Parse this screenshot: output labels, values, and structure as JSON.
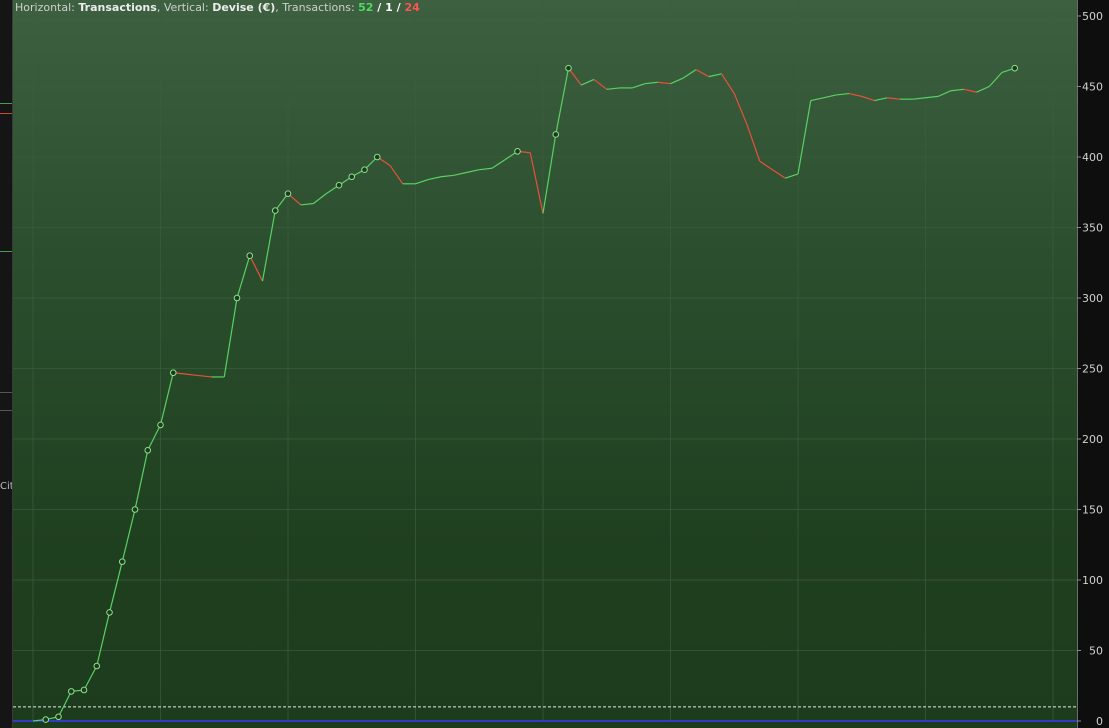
{
  "header": {
    "horizontal_label": "Horizontal:",
    "horizontal_value": "Transactions",
    "vertical_label": "Vertical:",
    "vertical_value": "Devise (€)",
    "transactions_label": "Transactions:",
    "count_green": "52",
    "separator1": " / ",
    "count_white": "1",
    "separator2": " / ",
    "count_red": "24"
  },
  "left_panel": {
    "cut_text": "Cité"
  },
  "colors": {
    "rise": "#59d163",
    "fall": "#e8503a",
    "marker_fill": "#1d3a1d",
    "grid": "#3c5c3f",
    "baseline": "#3b3bff",
    "dashed": "#e8e8e8"
  },
  "chart_data": {
    "type": "line",
    "title": "",
    "xlabel": "Transactions",
    "ylabel": "Devise (€)",
    "xlim": [
      0,
      82
    ],
    "ylim": [
      0,
      500
    ],
    "yticks": [
      0,
      50,
      100,
      150,
      200,
      250,
      300,
      350,
      400,
      450,
      500
    ],
    "threshold_line": 10,
    "grid": true,
    "series": [
      {
        "values": [
          0,
          1,
          3,
          21,
          22,
          39,
          77,
          113,
          150,
          192,
          210,
          247,
          246,
          245,
          244,
          244,
          300,
          330,
          312,
          362,
          374,
          366,
          367,
          374,
          380,
          386,
          391,
          400,
          394,
          381,
          381,
          384,
          386,
          387,
          389,
          391,
          392,
          398,
          404,
          403,
          360,
          416,
          463,
          451,
          455,
          448,
          449,
          449,
          452,
          453,
          452,
          456,
          462,
          457,
          459,
          445,
          423,
          397,
          391,
          385,
          388,
          440,
          442,
          444,
          445,
          443,
          440,
          442,
          441,
          441,
          442,
          443,
          447,
          448,
          446,
          450,
          460,
          463
        ],
        "markers": [
          1,
          2,
          3,
          4,
          5,
          6,
          7,
          8,
          9,
          10,
          11,
          16,
          17,
          19,
          20,
          24,
          25,
          26,
          27,
          38,
          41,
          42,
          77
        ]
      }
    ]
  }
}
